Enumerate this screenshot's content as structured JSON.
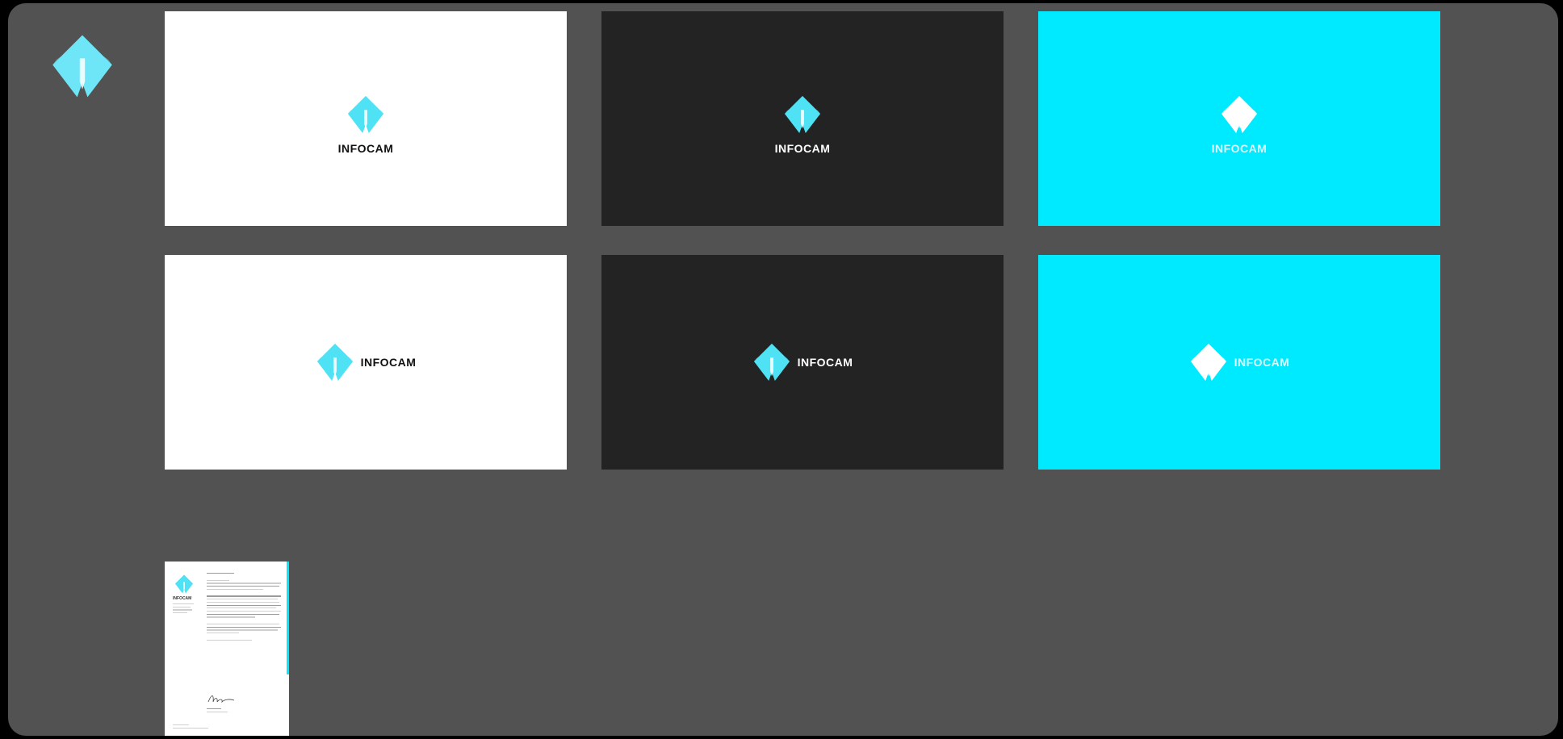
{
  "colors": {
    "brand_cyan": "#00eaff",
    "dark": "#232323",
    "canvas": "#525252"
  },
  "app": {
    "logo_icon": "infocam-mark-icon"
  },
  "artboards": [
    {
      "name": "",
      "brand": "INFOCAM",
      "variant": "stacked",
      "background": "white"
    },
    {
      "name": "",
      "brand": "INFOCAM",
      "variant": "stacked",
      "background": "dark"
    },
    {
      "name": "",
      "brand": "INFOCAM",
      "variant": "stacked",
      "background": "cyan"
    },
    {
      "name": "",
      "brand": "INFOCAM",
      "variant": "horizontal",
      "background": "white"
    },
    {
      "name": "",
      "brand": "INFOCAM",
      "variant": "horizontal",
      "background": "dark"
    },
    {
      "name": "",
      "brand": "INFOCAM",
      "variant": "horizontal",
      "background": "cyan"
    }
  ],
  "letterhead": {
    "brand": "INFOCAM",
    "icon": "infocam-mark-icon"
  }
}
